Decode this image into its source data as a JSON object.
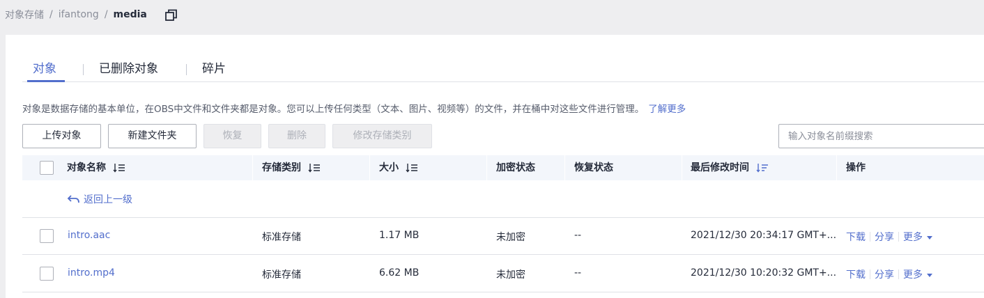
{
  "breadcrumb": {
    "items": [
      "对象存储",
      "ifantong"
    ],
    "separator": "/",
    "current": "media"
  },
  "tabs": [
    {
      "label": "对象",
      "active": true
    },
    {
      "label": "已删除对象",
      "active": false
    },
    {
      "label": "碎片",
      "active": false
    }
  ],
  "description": {
    "text": "对象是数据存储的基本单位，在OBS中文件和文件夹都是对象。您可以上传任何类型（文本、图片、视频等）的文件，并在桶中对这些文件进行管理。",
    "link": "了解更多"
  },
  "toolbar": {
    "upload": "上传对象",
    "new_folder": "新建文件夹",
    "restore": "恢复",
    "delete": "删除",
    "change_class": "修改存储类别",
    "search_placeholder": "输入对象名前缀搜索"
  },
  "table": {
    "columns": [
      "对象名称",
      "存储类别",
      "大小",
      "加密状态",
      "恢复状态",
      "最后修改时间",
      "操作"
    ],
    "back_label": "返回上一级",
    "rows": [
      {
        "name": "intro.aac",
        "storage_class": "标准存储",
        "size": "1.17 MB",
        "encryption": "未加密",
        "restore": "--",
        "modified": "2021/12/30 20:34:17 GMT+..."
      },
      {
        "name": "intro.mp4",
        "storage_class": "标准存储",
        "size": "6.62 MB",
        "encryption": "未加密",
        "restore": "--",
        "modified": "2021/12/30 10:20:32 GMT+..."
      }
    ],
    "ops": {
      "download": "下载",
      "share": "分享",
      "more": "更多"
    }
  },
  "colors": {
    "accent": "#526ecc",
    "text": "#252b3a",
    "muted": "#8a8e99",
    "header_bg": "#f3f6fb"
  }
}
